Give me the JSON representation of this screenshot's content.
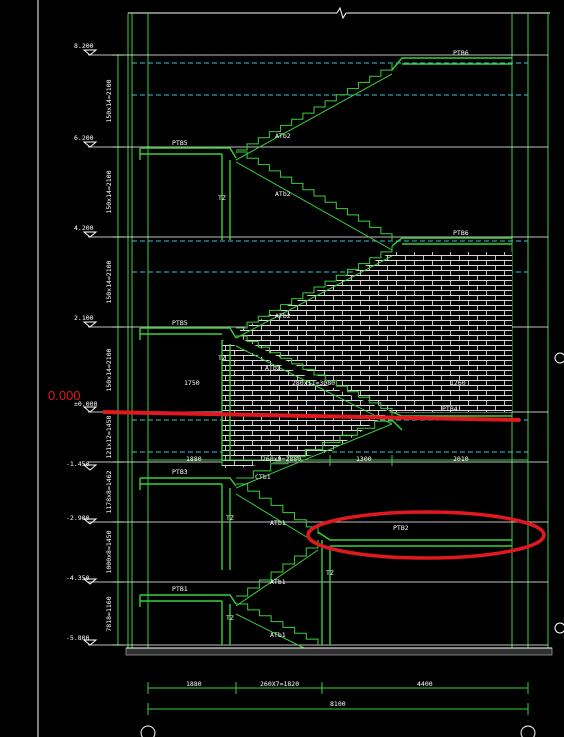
{
  "drawing": {
    "elevation_marks": [
      "8.200",
      "6.200",
      "4.200",
      "2.100",
      "±0.000",
      "-1.450",
      "-2.900",
      "-4.350",
      "-5.800"
    ],
    "storey_dims": [
      "150x14=2100",
      "150x14=2100",
      "150x14=2100",
      "150x14=2100",
      "121x12=1450",
      "1178x8=1462",
      "1000x8=1450",
      "7818=1160"
    ],
    "labels": {
      "ptb6_top": "PTB6",
      "ptb6_mid": "PTB6",
      "ptb5_upper": "PTB5",
      "ptb5_lower": "PTB5",
      "ptb4": "PTB4",
      "ptb3": "PTB3",
      "ptb2": "PTB2",
      "ptb1": "PTB1",
      "atb2_a": "ATb2",
      "atb2_b": "ATb2",
      "atb2_c": "ATb2",
      "atb2_d": "ATb2",
      "ctb1": "CTb1",
      "atb1_a": "ATb1",
      "atb1_b": "ATb1",
      "atb1_c": "ATb1",
      "tz_a": "TZ",
      "tz_b": "TZ",
      "tz_c": "TZ",
      "tz_d": "TZ",
      "tz_e": "TZ",
      "dim_1750": "1750",
      "dim_mid": "280x11=3080",
      "dim_1260": "1260",
      "dim_1880_mid": "1880",
      "dim_260x9": "260x9=2880",
      "dim_1300": "1300",
      "dim_2010": "2010",
      "dim_1880_bot": "1880",
      "dim_260x7": "260X7=1820",
      "dim_4400": "4400",
      "dim_8100": "8100"
    }
  },
  "annotations": {
    "zero_label": "0.000",
    "zero_line_color": "#e0191e",
    "ellipse_color": "#e0191e"
  },
  "colors": {
    "structure": "#39d13a",
    "hidden": "#39c6d8",
    "text": "#ffffff",
    "background": "#000000"
  }
}
